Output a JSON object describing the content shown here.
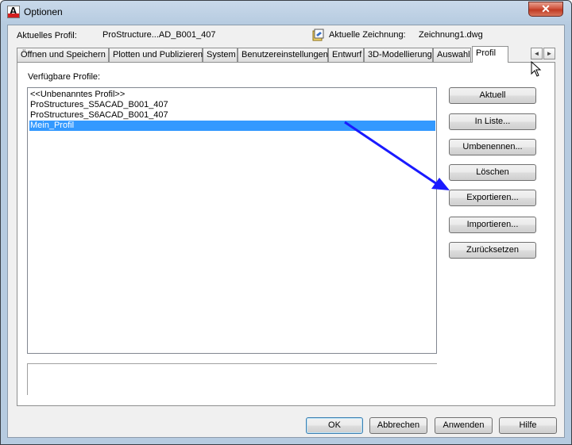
{
  "window": {
    "title": "Optionen",
    "close_label": "✕"
  },
  "header": {
    "current_profile_label": "Aktuelles Profil:",
    "current_profile_value": "ProStructure...AD_B001_407",
    "current_drawing_label": "Aktuelle Zeichnung:",
    "current_drawing_value": "Zeichnung1.dwg"
  },
  "tabs": [
    {
      "label": "Öffnen und Speichern"
    },
    {
      "label": "Plotten und Publizieren"
    },
    {
      "label": "System"
    },
    {
      "label": "Benutzereinstellungen"
    },
    {
      "label": "Entwurf"
    },
    {
      "label": "3D-Modellierung"
    },
    {
      "label": "Auswahl"
    },
    {
      "label": "Profil",
      "active": true
    }
  ],
  "tab_scroll": {
    "left": "◄",
    "right": "►"
  },
  "profiles": {
    "label": "Verfügbare Profile:",
    "items": [
      {
        "label": "<<Unbenanntes Profil>>"
      },
      {
        "label": "ProStructures_S5ACAD_B001_407"
      },
      {
        "label": "ProStructures_S6ACAD_B001_407"
      },
      {
        "label": "Mein_Profil",
        "selected": true
      }
    ]
  },
  "side_buttons": {
    "current": "Aktuell",
    "to_list": "In Liste...",
    "rename": "Umbenennen...",
    "delete": "Löschen",
    "export": "Exportieren...",
    "import": "Importieren...",
    "reset": "Zurücksetzen"
  },
  "footer": {
    "ok": "OK",
    "cancel": "Abbrechen",
    "apply": "Anwenden",
    "help": "Hilfe"
  },
  "colors": {
    "selection": "#3399ff",
    "annotation_arrow": "#1a1aff",
    "close_button": "#c03b24"
  }
}
